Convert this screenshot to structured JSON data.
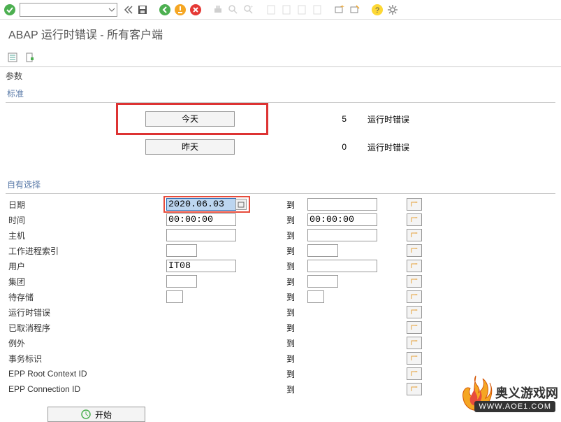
{
  "header": {
    "title": "ABAP 运行时错误 - 所有客户端"
  },
  "sections": {
    "params": "参数",
    "standard": "标准",
    "own": "自有选择"
  },
  "std": {
    "today": {
      "label": "今天",
      "count": "5",
      "desc": "运行时错误"
    },
    "yesterday": {
      "label": "昨天",
      "count": "0",
      "desc": "运行时错误"
    }
  },
  "filters": {
    "date": {
      "label": "日期",
      "from": "2020.06.03",
      "to_label": "到",
      "to": ""
    },
    "time": {
      "label": "时间",
      "from": "00:00:00",
      "to_label": "到",
      "to": "00:00:00"
    },
    "host": {
      "label": "主机",
      "from": "",
      "to_label": "到",
      "to": ""
    },
    "wpindex": {
      "label": "工作进程索引",
      "from": "",
      "to_label": "到",
      "to": ""
    },
    "user": {
      "label": "用户",
      "from": "IT08",
      "to_label": "到",
      "to": ""
    },
    "client": {
      "label": "集团",
      "from": "",
      "to_label": "到",
      "to": ""
    },
    "keep": {
      "label": "待存储",
      "from": "",
      "to_label": "到",
      "to": ""
    },
    "rterror": {
      "label": "运行时错误",
      "from": "",
      "to_label": "到",
      "to": ""
    },
    "canceled": {
      "label": "已取消程序",
      "from": "",
      "to_label": "到",
      "to": ""
    },
    "exception": {
      "label": "例外",
      "from": "",
      "to_label": "到",
      "to": ""
    },
    "trans": {
      "label": "事务标识",
      "from": "",
      "to_label": "到",
      "to": ""
    },
    "eppRoot": {
      "label": "EPP Root Context ID",
      "from": "",
      "to_label": "到",
      "to": ""
    },
    "eppConn": {
      "label": "EPP Connection ID",
      "from": "",
      "to_label": "到",
      "to": ""
    }
  },
  "buttons": {
    "start": "开始"
  },
  "watermark": {
    "text": "奥义游戏网",
    "url": "WWW.AOE1.COM"
  }
}
